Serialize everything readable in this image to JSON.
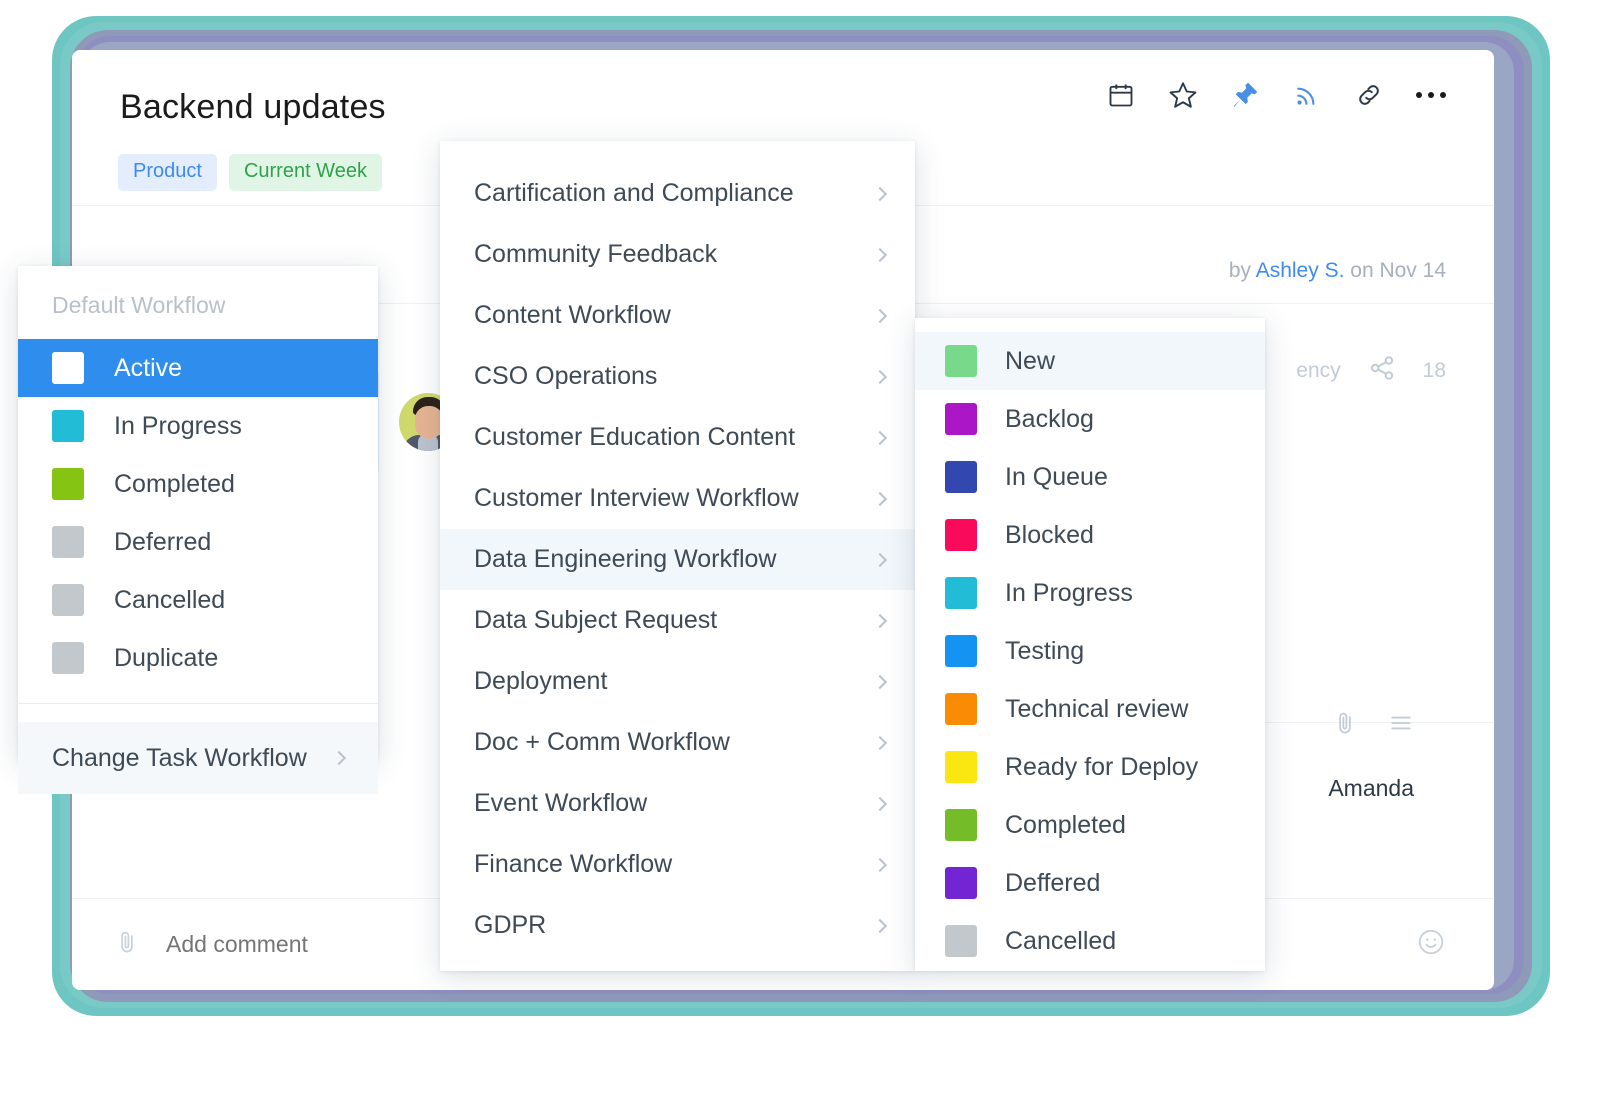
{
  "header": {
    "title": "Backend updates",
    "tags": [
      {
        "label": "Product",
        "color": "#3d8bf2",
        "bg": "#e3edfc"
      },
      {
        "label": "Current Week",
        "color": "#2fa24b",
        "bg": "#e1f5e6"
      }
    ],
    "icons": [
      {
        "name": "calendar-icon",
        "color": "#2d3a46"
      },
      {
        "name": "star-icon",
        "color": "#2d3a46"
      },
      {
        "name": "pin-icon",
        "color": "#4a90e2"
      },
      {
        "name": "follow-rss-icon",
        "color": "#4a90e2"
      },
      {
        "name": "link-icon",
        "color": "#2d3a46"
      },
      {
        "name": "more-options-icon",
        "color": "#1b1b1b"
      }
    ]
  },
  "task": {
    "status_label": "Active",
    "byline_prefix": "by",
    "byline_author": "Ashley S.",
    "byline_suffix": "on Nov 14",
    "meta_partial_text": "ency",
    "share_count": "18",
    "assignee": "Amanda"
  },
  "comment": {
    "placeholder": "Add comment",
    "attach_icon": "paperclip-icon",
    "emoji_icon": "smiley-icon"
  },
  "status_panel": {
    "caption": "Default Workflow",
    "items": [
      {
        "label": "Active",
        "color": "#2f8dee",
        "selected": true
      },
      {
        "label": "In Progress",
        "color": "#22bcd6",
        "selected": false
      },
      {
        "label": "Completed",
        "color": "#86c414",
        "selected": false
      },
      {
        "label": "Deferred",
        "color": "#c3c8cd",
        "selected": false
      },
      {
        "label": "Cancelled",
        "color": "#c3c8cd",
        "selected": false
      },
      {
        "label": "Duplicate",
        "color": "#c3c8cd",
        "selected": false
      }
    ],
    "footer_label": "Change Task Workflow"
  },
  "workflow_panel": {
    "items": [
      {
        "label": "Cartification and Compliance",
        "active": false
      },
      {
        "label": "Community Feedback",
        "active": false
      },
      {
        "label": "Content Workflow",
        "active": false
      },
      {
        "label": "CSO Operations",
        "active": false
      },
      {
        "label": "Customer Education Content",
        "active": false
      },
      {
        "label": "Customer Interview Workflow",
        "active": false
      },
      {
        "label": "Data Engineering Workflow",
        "active": true
      },
      {
        "label": "Data Subject Request",
        "active": false
      },
      {
        "label": "Deployment",
        "active": false
      },
      {
        "label": "Doc + Comm Workflow",
        "active": false
      },
      {
        "label": "Event Workflow",
        "active": false
      },
      {
        "label": "Finance Workflow",
        "active": false
      },
      {
        "label": "GDPR",
        "active": false
      }
    ]
  },
  "status_submenu": {
    "items": [
      {
        "label": "New",
        "color": "#79d98a",
        "active": true
      },
      {
        "label": "Backlog",
        "color": "#ab16c7",
        "active": false
      },
      {
        "label": "In Queue",
        "color": "#3347b0",
        "active": false
      },
      {
        "label": "Blocked",
        "color": "#fa0a5a",
        "active": false
      },
      {
        "label": "In Progress",
        "color": "#22bcd6",
        "active": false
      },
      {
        "label": "Testing",
        "color": "#1493f3",
        "active": false
      },
      {
        "label": "Technical review",
        "color": "#fa8c05",
        "active": false
      },
      {
        "label": "Ready for Deploy",
        "color": "#fae711",
        "active": false
      },
      {
        "label": "Completed",
        "color": "#74bd28",
        "active": false
      },
      {
        "label": "Deffered",
        "color": "#7325d4",
        "active": false
      },
      {
        "label": "Cancelled",
        "color": "#c3c8cd",
        "active": false
      }
    ]
  },
  "theme": {
    "accent": "#2f8dee",
    "frame_teal": "#6ec6c2",
    "frame_violet": "#8e8fc0"
  }
}
